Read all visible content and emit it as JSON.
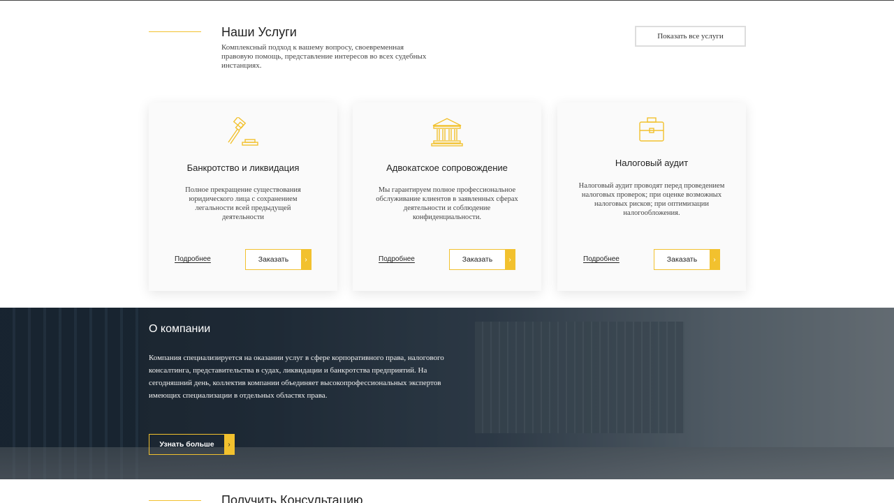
{
  "services": {
    "title": "Наши Услуги",
    "description": "Комплексный подход к вашему вопросу, своевременная правовую помощь, представление интересов во всех судебных инстанциях.",
    "show_all_label": "Показать все услуги",
    "cards": [
      {
        "icon": "gavel-icon",
        "title": "Банкротство и ликвидация",
        "description": "Полное прекращение существования юридического лица с сохранением легальности всей предыдущей деятельности",
        "more_label": "Подробнее",
        "order_label": "Заказать",
        "arrow": "›"
      },
      {
        "icon": "courthouse-icon",
        "title": "Адвокатское сопровождение",
        "description": "Мы гарантируем полное профессиональное обслуживание клиентов в заявленных сферах деятельности и соблюдение конфиденциальности.",
        "more_label": "Подробнее",
        "order_label": "Заказать",
        "arrow": "›"
      },
      {
        "icon": "briefcase-icon",
        "title": "Налоговый аудит",
        "description": "Налоговый аудит проводят перед проведением налоговых проверок; при оценке возможных налоговых рисков; при оптимизации налогообложения.",
        "more_label": "Подробнее",
        "order_label": "Заказать",
        "arrow": "›"
      }
    ]
  },
  "about": {
    "title": "О компании",
    "text": "Компания специализируется на оказании услуг в сфере корпоративного права, налогового консалтинга, представительства в судах, ликвидации и банкротства предприятий. На сегодняшний день, коллектив компании объединяет высокопрофессиональных экспертов имеющих специализации в отдельных областях права.",
    "button_label": "Узнать больше",
    "arrow": "›"
  },
  "consultation": {
    "title": "Получить Консультацию"
  },
  "colors": {
    "accent": "#f2c12e",
    "text": "#222222",
    "card_bg": "#fafafa"
  }
}
